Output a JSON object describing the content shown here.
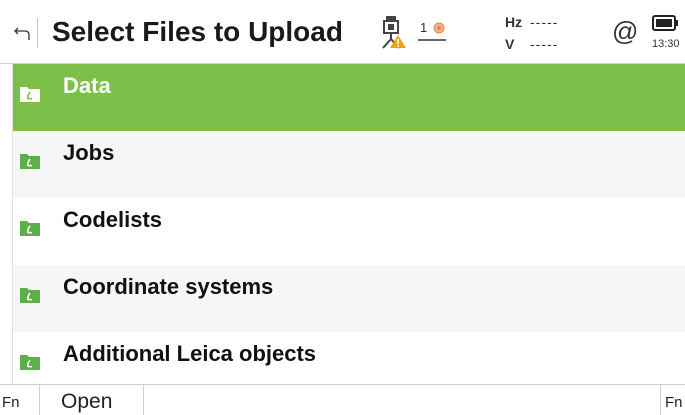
{
  "header": {
    "title": "Select Files to Upload",
    "face_indicator": "1",
    "hz_label": "Hz",
    "hz_value": "-----",
    "v_label": "V",
    "v_value": "-----",
    "connection_symbol": "@",
    "time": "13:30"
  },
  "list": {
    "items": [
      {
        "label": "Data",
        "icon": "folder-icon",
        "selected": true
      },
      {
        "label": "Jobs",
        "icon": "folder-icon",
        "selected": false
      },
      {
        "label": "Codelists",
        "icon": "folder-icon",
        "selected": false
      },
      {
        "label": "Coordinate systems",
        "icon": "folder-icon",
        "selected": false
      },
      {
        "label": "Additional Leica objects",
        "icon": "folder-icon",
        "selected": false
      }
    ]
  },
  "softkeys": {
    "fn_left": "Fn",
    "open": "Open",
    "fn_right": "Fn"
  },
  "colors": {
    "selection": "#7cc04a",
    "folder": "#5bb04a",
    "warning": "#f0a020"
  }
}
